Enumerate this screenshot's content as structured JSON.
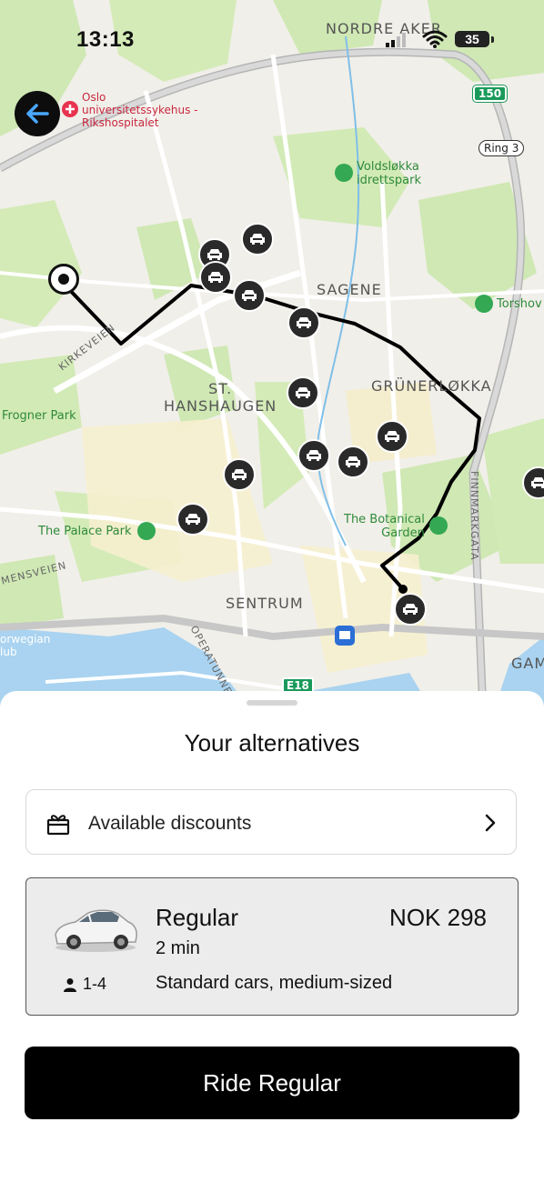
{
  "status_bar": {
    "time": "13:13",
    "battery": "35"
  },
  "map": {
    "labels": {
      "nordre_aker": "NORDRE AKER",
      "hospital_line1": "Oslo",
      "hospital_line2": "universitetssykehus -",
      "hospital_line3": "Rikshospitalet",
      "ring3": "Ring 3",
      "route150": "150",
      "voldslokka_line1": "Voldsløkka",
      "voldslokka_line2": "idrettspark",
      "torshov": "Torshov",
      "sagene": "SAGENE",
      "kirkeveien": "KIRKEVEIEN",
      "st_hanshaugen_line1": "ST.",
      "st_hanshaugen_line2": "HANSHAUGEN",
      "grunerlokka": "GRÜNERLØKKA",
      "frogner_park": "Frogner Park",
      "finnmarkgata": "FINNMARKGATA",
      "botanical_line1": "The Botanical",
      "botanical_line2": "Garden",
      "palace_park": "The Palace Park",
      "sentrum": "SENTRUM",
      "mensveien": "MENSVEIEN",
      "norwegian_line1": "orwegian",
      "norwegian_line2": "lub",
      "operatunnelen": "OPERATUNNELEN",
      "e18": "E18",
      "gam": "GAM"
    }
  },
  "sheet": {
    "title": "Your alternatives",
    "discounts_label": "Available discounts",
    "option": {
      "name": "Regular",
      "price": "NOK 298",
      "eta": "2 min",
      "passengers": "1-4",
      "description": "Standard cars, medium-sized"
    },
    "ride_button": "Ride Regular"
  },
  "colors": {
    "accent": "#000000",
    "back_arrow": "#4aa8ff",
    "park_green": "#cfe8b4",
    "water": "#a9d3f0"
  }
}
